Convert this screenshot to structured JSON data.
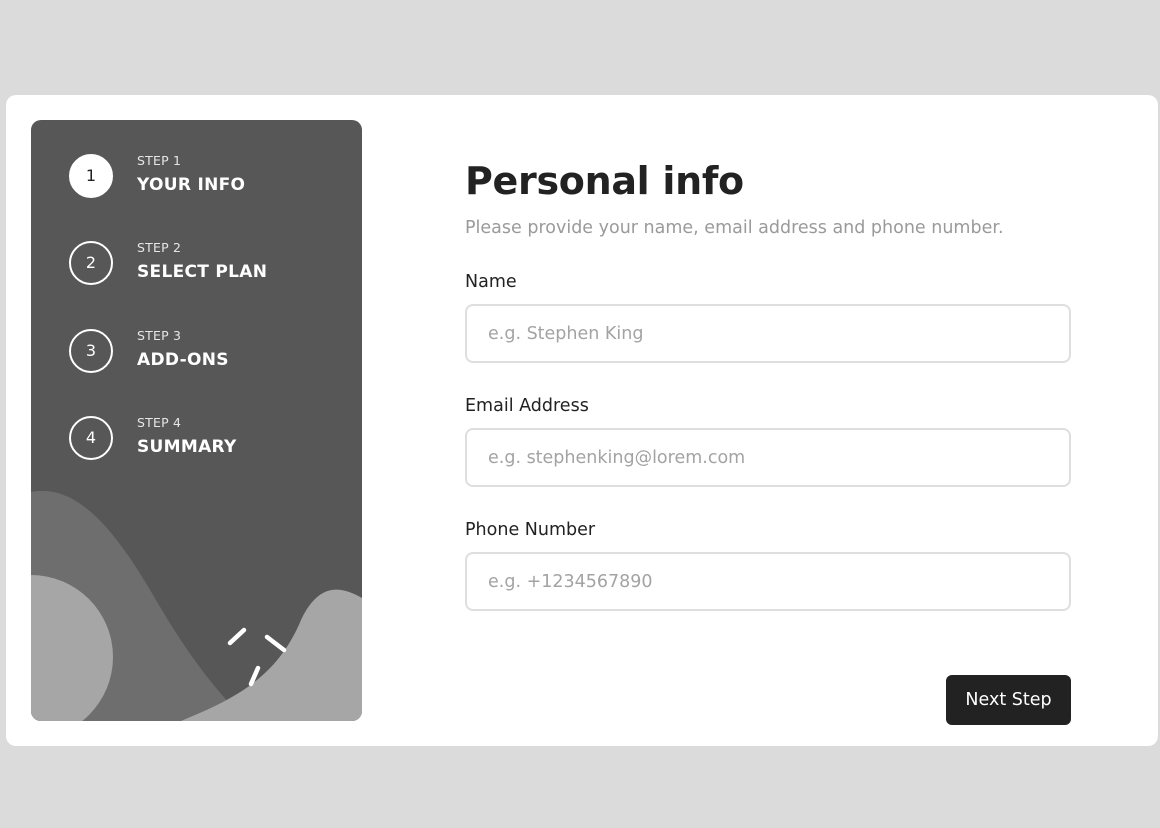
{
  "sidebar": {
    "steps": [
      {
        "number": "1",
        "step_label": "STEP 1",
        "title": "YOUR INFO",
        "active": true
      },
      {
        "number": "2",
        "step_label": "STEP 2",
        "title": "SELECT PLAN",
        "active": false
      },
      {
        "number": "3",
        "step_label": "STEP 3",
        "title": "ADD-ONS",
        "active": false
      },
      {
        "number": "4",
        "step_label": "STEP 4",
        "title": "SUMMARY",
        "active": false
      }
    ]
  },
  "main": {
    "title": "Personal info",
    "subtitle": "Please provide your name, email address and phone number.",
    "fields": [
      {
        "label": "Name",
        "placeholder": "e.g. Stephen King",
        "value": ""
      },
      {
        "label": "Email Address",
        "placeholder": "e.g. stephenking@lorem.com",
        "value": ""
      },
      {
        "label": "Phone Number",
        "placeholder": "e.g. +1234567890",
        "value": ""
      }
    ],
    "next_label": "Next Step"
  },
  "colors": {
    "background": "#dbdbdb",
    "sidebar": "#575757",
    "primary_text": "#222222",
    "muted_text": "#9a9a9a",
    "input_border": "#dedede",
    "button": "#222222"
  }
}
